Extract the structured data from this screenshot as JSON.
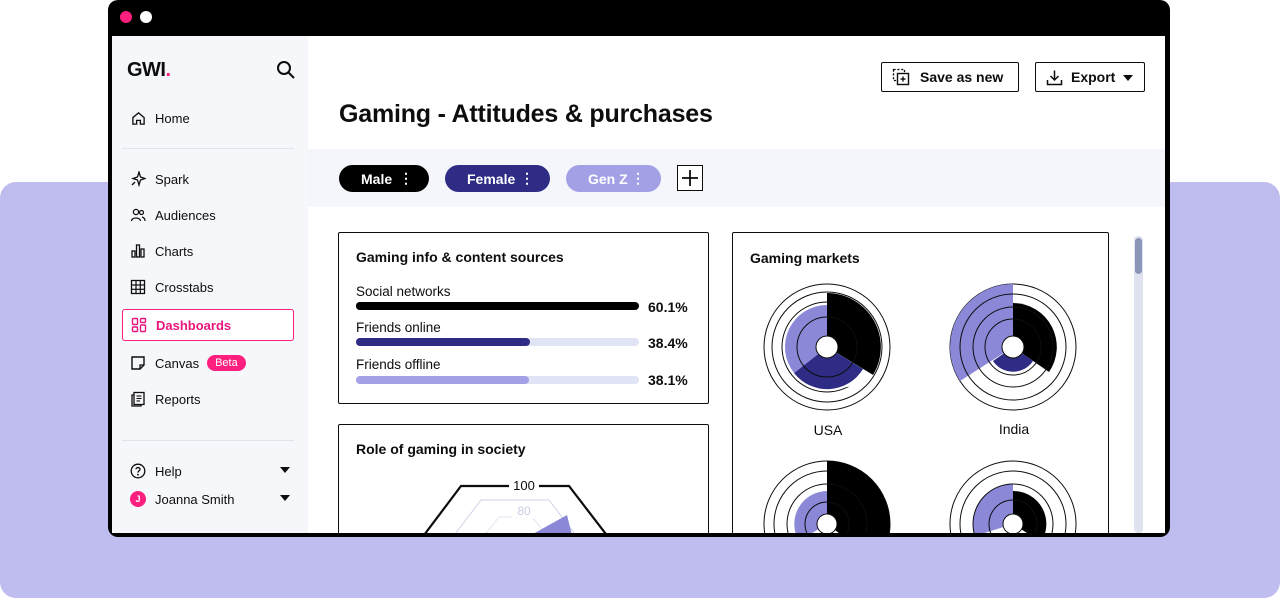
{
  "brand": {
    "logo_text": "GWI",
    "logo_dot": ".",
    "accent": "#ff1f7f"
  },
  "sidebar": {
    "items": [
      {
        "label": "Home",
        "icon": "home-icon"
      },
      {
        "label": "Spark",
        "icon": "sparkle-icon"
      },
      {
        "label": "Audiences",
        "icon": "users-icon"
      },
      {
        "label": "Charts",
        "icon": "bar-chart-icon"
      },
      {
        "label": "Crosstabs",
        "icon": "table-icon"
      },
      {
        "label": "Dashboards",
        "icon": "dashboard-icon",
        "active": true
      },
      {
        "label": "Canvas",
        "icon": "canvas-icon",
        "badge": "Beta"
      },
      {
        "label": "Reports",
        "icon": "reports-icon"
      }
    ],
    "help_label": "Help",
    "user": {
      "name": "Joanna Smith",
      "initial": "J"
    }
  },
  "toolbar": {
    "save_label": "Save as new",
    "export_label": "Export"
  },
  "page": {
    "title": "Gaming - Attitudes & purchases"
  },
  "filters": [
    {
      "label": "Male",
      "color": "#000000"
    },
    {
      "label": "Female",
      "color": "#2e2c85"
    },
    {
      "label": "Gen Z",
      "color": "#a3a0e6"
    }
  ],
  "card_info": {
    "title": "Gaming info & content sources",
    "rows": [
      {
        "label": "Social networks",
        "value": 60.1,
        "value_text": "60.1%",
        "color": "#000000",
        "track": "#000000"
      },
      {
        "label": "Friends online",
        "value": 38.4,
        "value_text": "38.4%",
        "color": "#2e2c85",
        "track": "#e1e4f4"
      },
      {
        "label": "Friends offline",
        "value": 38.1,
        "value_text": "38.1%",
        "color": "#a3a0e6",
        "track": "#e1e4f4"
      }
    ]
  },
  "card_role": {
    "title": "Role of gaming in society",
    "radar_ticks": [
      "100",
      "80"
    ]
  },
  "card_markets": {
    "title": "Gaming markets",
    "markets": [
      "USA",
      "India"
    ]
  },
  "colors": {
    "black": "#000000",
    "navy": "#2e2c85",
    "lavender": "#a3a0e6",
    "band": "#bfbdf0"
  }
}
